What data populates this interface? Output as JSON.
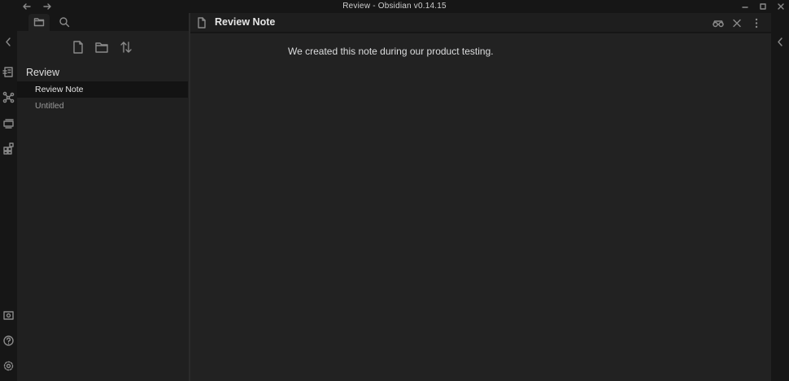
{
  "window": {
    "title": "Review - Obsidian v0.14.15"
  },
  "titlebar": {
    "back_icon": "arrow-left-icon",
    "forward_icon": "arrow-right-icon",
    "controls": [
      "minimize-icon",
      "maximize-icon",
      "close-icon"
    ]
  },
  "ribbon": {
    "icons": [
      "collapse-left-icon",
      "quick-switcher-icon",
      "graph-view-icon",
      "slides-icon",
      "templates-icon",
      "vault-switcher-icon",
      "help-icon",
      "settings-icon"
    ]
  },
  "sidebar": {
    "tabs": [
      "folder-icon",
      "search-icon"
    ],
    "actions": [
      "new-note-icon",
      "new-folder-icon",
      "sort-icon"
    ],
    "vault": "Review",
    "files": [
      {
        "name": "Review Note",
        "active": true
      },
      {
        "name": "Untitled",
        "active": false
      }
    ]
  },
  "editor": {
    "title": "Review Note",
    "actions": [
      "reading-view-icon",
      "close-icon",
      "more-options-icon"
    ],
    "body": "We created this note during our product testing."
  },
  "right_ribbon": {
    "icons": [
      "collapse-right-icon"
    ]
  },
  "colors": {
    "background": "#161616",
    "sidebar": "#202020",
    "editor": "#222222",
    "text": "#dcddde",
    "muted": "#9a9a9a"
  }
}
